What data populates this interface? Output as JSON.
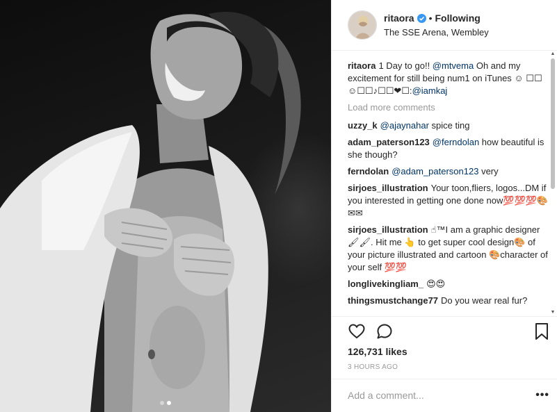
{
  "post": {
    "username": "ritaora",
    "follow_state": "Following",
    "separator": "•",
    "location": "The SSE Arena, Wembley",
    "caption": {
      "user": "ritaora",
      "text_1": "1 Day to go!! ",
      "mention_1": "@mtvema",
      "text_2": " Oh and my excitement for still being num1 on iTunes ☺ ☐☐☺☐☐♪☐☐❤☐:",
      "mention_2": "@iamkaj"
    },
    "load_more": "Load more comments",
    "comments": [
      {
        "user": "uzzy_k",
        "mention": "@ajaynahar",
        "text": " spice ting"
      },
      {
        "user": "adam_paterson123",
        "mention": "@ferndolan",
        "text": " how beautiful is she though?"
      },
      {
        "user": "ferndolan",
        "mention": "@adam_paterson123",
        "text": " very"
      },
      {
        "user": "sirjoes_illustration",
        "mention": "",
        "text": "Your toon,fliers, logos...DM if you interested in getting one done now💯💯💯🎨✉✉"
      },
      {
        "user": "sirjoes_illustration",
        "mention": "",
        "text": "☝™I am a graphic designer🖌🖌. Hit me 👆 to get super cool design🎨 of your picture illustrated and cartoon 🎨character of your self 💯💯"
      },
      {
        "user": "longlivekingliam_",
        "mention": "",
        "text": "😍😍"
      },
      {
        "user": "thingsmustchange77",
        "mention": "",
        "text": "Do you wear real fur?"
      }
    ],
    "likes": "126,731 likes",
    "time": "3 HOURS AGO",
    "comment_placeholder": "Add a comment...",
    "more_label": "•••"
  },
  "icons": {
    "like": "heart-icon",
    "comment": "comment-bubble-icon",
    "save": "bookmark-icon",
    "verified": "verified-badge-icon"
  },
  "colors": {
    "verified": "#3897f0",
    "mention": "#003569",
    "muted": "#999999"
  },
  "carousel": {
    "count": 2,
    "active": 2
  }
}
